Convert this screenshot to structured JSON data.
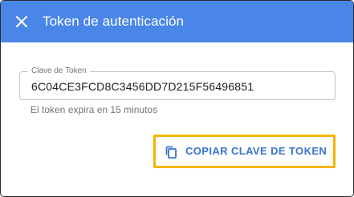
{
  "dialog": {
    "title": "Token de autenticación",
    "close_icon": "close-icon"
  },
  "token_field": {
    "label": "Clave de Token",
    "value": "6C04CE3FCD8C3456DD7D215F56496851"
  },
  "helper_text": "El token expira en 15 minutos",
  "copy_button": {
    "label": "COPIAR CLAVE DE TOKEN",
    "icon": "copy-icon"
  },
  "colors": {
    "header": "#4a86e8",
    "accent": "#3b73d1",
    "highlight": "#f5b400"
  }
}
